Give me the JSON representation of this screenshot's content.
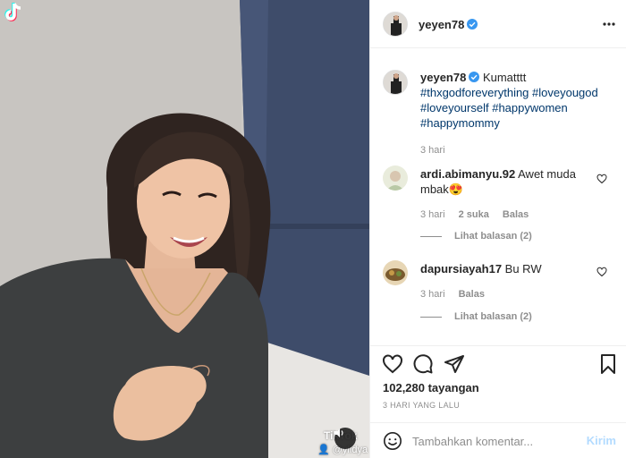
{
  "colors": {
    "accent": "#0095f6",
    "link": "#00376b",
    "muted": "#8e8e8e",
    "text": "#262626",
    "verified": "#3897f0"
  },
  "header": {
    "username": "yeyen78",
    "more_icon": "ellipsis-icon"
  },
  "caption": {
    "username": "yeyen78",
    "text": "Kumatttt",
    "hashtags_line1": "#thxgodforeverything #loveyougod",
    "hashtags_line2": "#loveyourself #happywomen",
    "hashtags_line3": "#happymommy",
    "time": "3 hari"
  },
  "comments": [
    {
      "username": "ardi.abimanyu.92",
      "text_line1": "Awet muda",
      "text_line2": "mbak",
      "emoji": "😍",
      "time": "3 hari",
      "likes": "2 suka",
      "reply": "Balas",
      "view_replies": "Lihat balasan (2)"
    },
    {
      "username": "dapursiayah17",
      "text": "Bu RW",
      "time": "3 hari",
      "reply": "Balas",
      "view_replies": "Lihat balasan (2)"
    }
  ],
  "actions": {
    "views": "102,280 tayangan",
    "posted": "3 HARI YANG LALU"
  },
  "add_comment": {
    "placeholder": "Tambahkan komentar...",
    "post_label": "Kirim"
  },
  "media": {
    "watermark_word": "TikTok",
    "watermark_user": "@ylidya"
  }
}
